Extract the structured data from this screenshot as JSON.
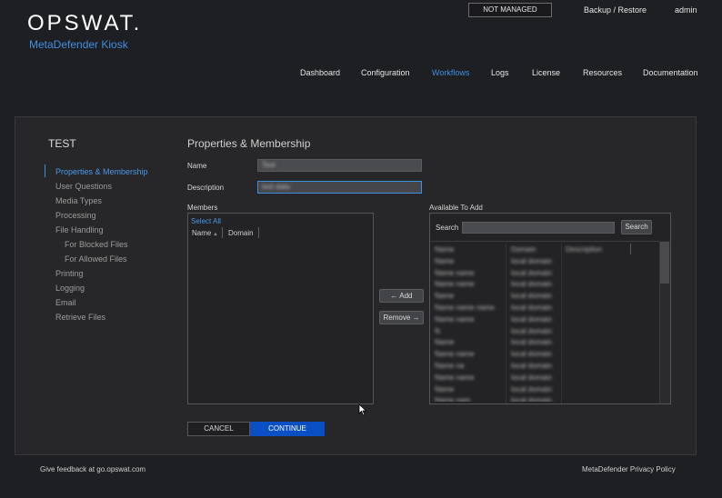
{
  "header": {
    "logo_text": "OPSWAT.",
    "product_name": "MetaDefender Kiosk",
    "status_badge": "NOT MANAGED",
    "backup_restore": "Backup / Restore",
    "user": "admin"
  },
  "nav": {
    "items": [
      "Dashboard",
      "Configuration",
      "Workflows",
      "Logs",
      "License",
      "Resources",
      "Documentation"
    ],
    "active": "Workflows"
  },
  "sidebar": {
    "title": "TEST",
    "items": [
      {
        "label": "Properties & Membership",
        "active": true
      },
      {
        "label": "User Questions"
      },
      {
        "label": "Media Types"
      },
      {
        "label": "Processing"
      },
      {
        "label": "File Handling"
      },
      {
        "label": "For Blocked Files",
        "sub": true
      },
      {
        "label": "For Allowed Files",
        "sub": true
      },
      {
        "label": "Printing"
      },
      {
        "label": "Logging"
      },
      {
        "label": "Email"
      },
      {
        "label": "Retrieve Files"
      }
    ]
  },
  "form": {
    "title": "Properties & Membership",
    "name_label": "Name",
    "name_value": "Test",
    "description_label": "Description",
    "description_value": "test data",
    "members_label": "Members",
    "select_all": "Select All",
    "col_name": "Name",
    "col_domain": "Domain",
    "available_label": "Available To Add",
    "search_label": "Search",
    "search_button": "Search",
    "add_button": "← Add",
    "remove_button": "Remove →",
    "cancel_button": "CANCEL",
    "continue_button": "CONTINUE"
  },
  "available_rows": [
    [
      "Name",
      "Domain",
      "Description"
    ],
    [
      "Name",
      "local domain",
      ""
    ],
    [
      "Name name",
      "local domain",
      ""
    ],
    [
      "Name name",
      "local domain",
      ""
    ],
    [
      "Name",
      "local domain",
      ""
    ],
    [
      "Name name name",
      "local domain",
      ""
    ],
    [
      "Name name",
      "local domain",
      ""
    ],
    [
      "N",
      "local domain",
      ""
    ],
    [
      "Name",
      "local domain",
      ""
    ],
    [
      "Name name",
      "local domain",
      ""
    ],
    [
      "Name na",
      "local domain",
      ""
    ],
    [
      "Name name",
      "local domain",
      ""
    ],
    [
      "Name",
      "local domain",
      ""
    ],
    [
      "Name nam",
      "local domain",
      ""
    ]
  ],
  "footer": {
    "feedback": "Give feedback at go.opswat.com",
    "privacy": "MetaDefender Privacy Policy"
  },
  "colors": {
    "accent": "#3f8fe0",
    "primary_button": "#0b4fc4",
    "background": "#1e1f22",
    "panel": "#272729"
  }
}
